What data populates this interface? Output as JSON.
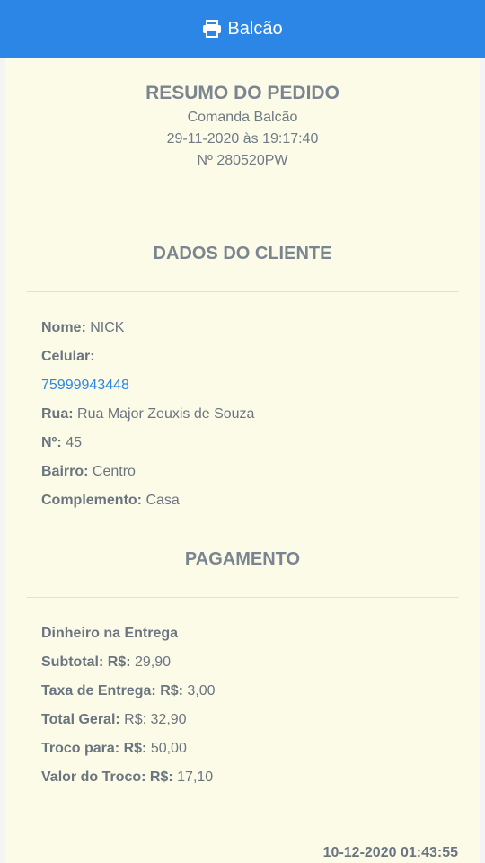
{
  "header": {
    "title": "Balcão",
    "icon": "printer-icon"
  },
  "summary": {
    "title": "RESUMO DO PEDIDO",
    "comanda": "Comanda Balcão",
    "datetime": "29-11-2020 às 19:17:40",
    "number": "Nº 280520PW"
  },
  "client": {
    "title": "DADOS DO CLIENTE",
    "name_label": "Nome:",
    "name": "NICK",
    "phone_label": "Celular:",
    "phone": "75999943448",
    "street_label": "Rua:",
    "street": "Rua Major Zeuxis de Souza",
    "num_label": "Nº:",
    "num": "45",
    "district_label": "Bairro:",
    "district": "Centro",
    "complement_label": "Complemento:",
    "complement": "Casa"
  },
  "payment": {
    "title": "PAGAMENTO",
    "method": "Dinheiro na Entrega",
    "subtotal_label": "Subtotal: R$:",
    "subtotal": "29,90",
    "delivery_label": "Taxa de Entrega: R$:",
    "delivery": "3,00",
    "total_label": "Total Geral:",
    "total": "R$: 32,90",
    "change_for_label": "Troco para: R$:",
    "change_for": "50,00",
    "change_value_label": "Valor do Troco: R$:",
    "change_value": "17,10"
  },
  "footer": {
    "timestamp": "10-12-2020 01:43:55"
  },
  "colors": {
    "header": "#2b86e6",
    "card": "#fbfbe7",
    "link": "#2b86e6"
  }
}
